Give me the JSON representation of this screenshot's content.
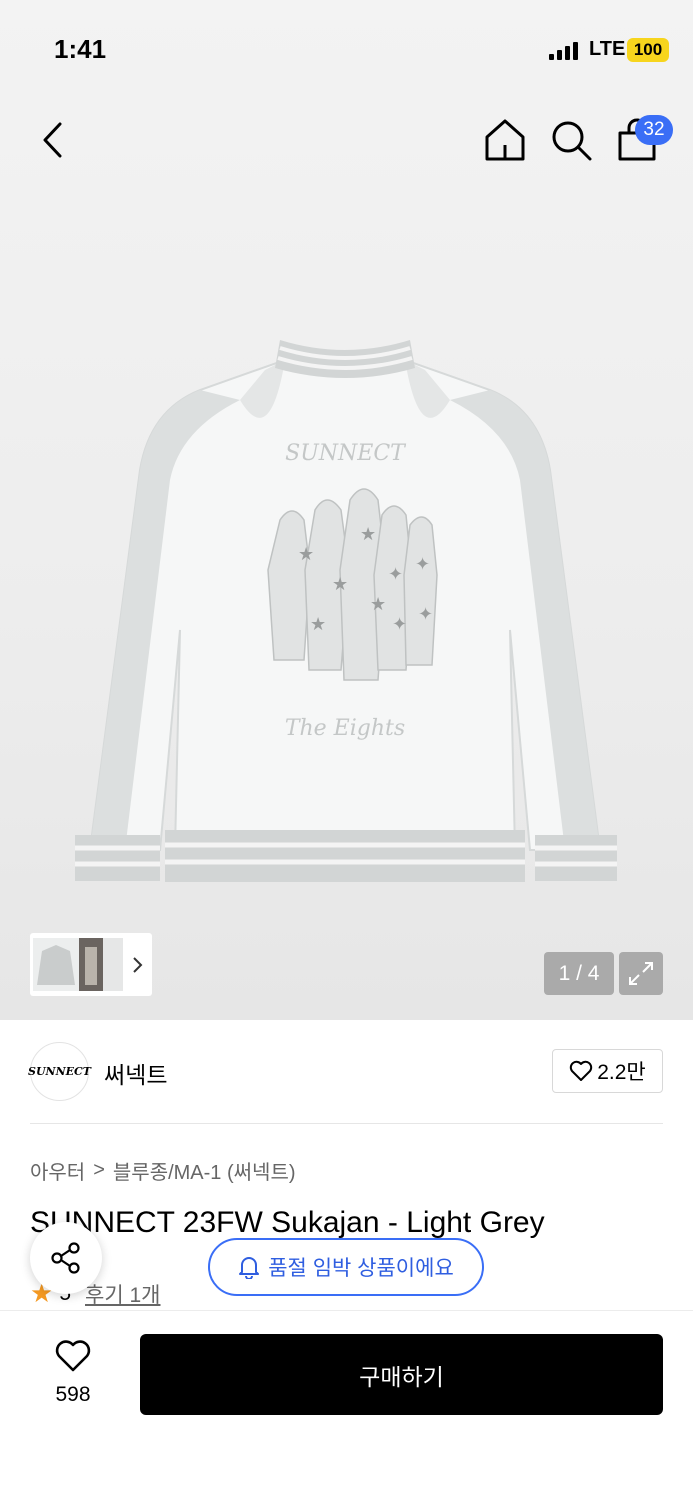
{
  "status_bar": {
    "time": "1:41",
    "network": "LTE",
    "battery": "100"
  },
  "header": {
    "cart_count": "32"
  },
  "gallery": {
    "counter": "1 / 4",
    "embroidery_top": "SUNNECT",
    "embroidery_bottom": "The Eights"
  },
  "brand": {
    "logo_text": "SUNNECT",
    "name": "써넥트",
    "likes": "2.2만"
  },
  "breadcrumb": {
    "category": "아우터",
    "separator": ">",
    "subcategory": "블루종/MA-1 (써넥트)"
  },
  "product": {
    "title": "SUNNECT 23FW Sukajan - Light Grey",
    "rating": "5",
    "review_link": "후기 1개"
  },
  "toast": {
    "message": "품절 임박 상품이에요"
  },
  "bottom_bar": {
    "wish_count": "598",
    "buy_label": "구매하기"
  },
  "colors": {
    "accent": "#3a6ef6",
    "battery": "#f7d51d",
    "star": "#f59a23",
    "buy_button": "#000000"
  }
}
